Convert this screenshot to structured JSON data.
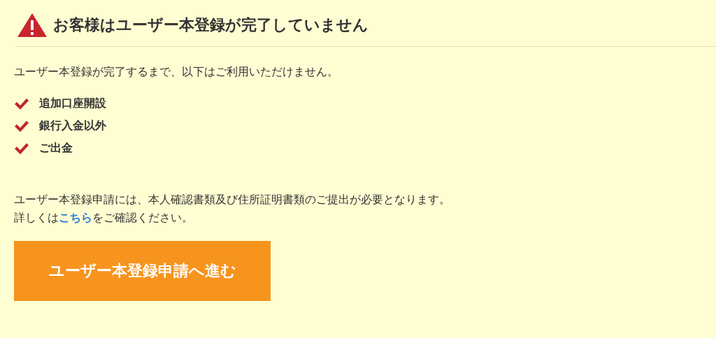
{
  "header": {
    "title": "お客様はユーザー本登録が完了していません"
  },
  "intro": "ユーザー本登録が完了するまで、以下はご利用いただけません。",
  "items": [
    "追加口座開設",
    "銀行入金以外",
    "ご出金"
  ],
  "note": "ユーザー本登録申請には、本人確認書類及び住所証明書類のご提出が必要となります。",
  "detail": {
    "before": "詳しくは",
    "link": "こちら",
    "after": "をご確認ください。"
  },
  "button": "ユーザー本登録申請へ進む"
}
